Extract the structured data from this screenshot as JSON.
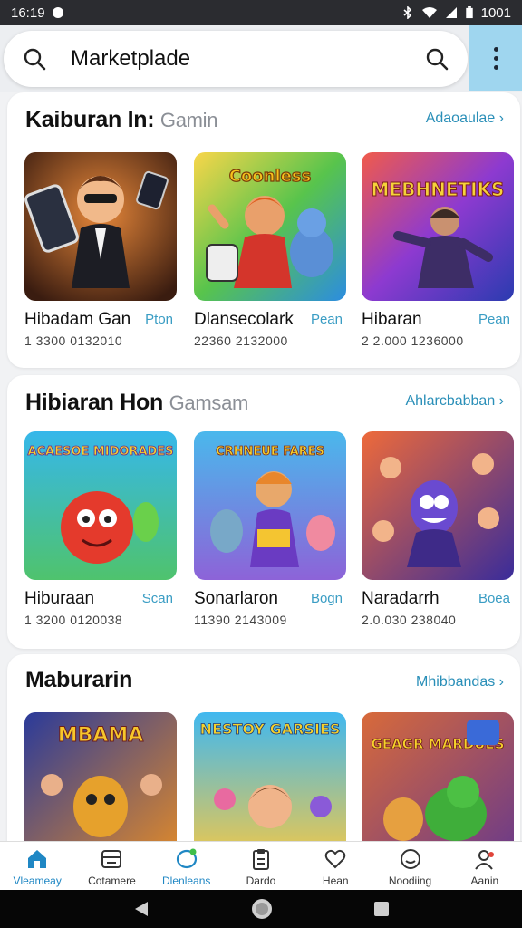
{
  "status": {
    "time": "16:19",
    "clock_right": "1001"
  },
  "header": {
    "title": "Marketplade"
  },
  "sections": [
    {
      "title": "Kaiburan In:",
      "title_muted": "Gamin",
      "link": "Adaoaulae",
      "games": [
        {
          "name": "Hibadam Gan",
          "tag": "Pton",
          "number": "1 3300 0132010"
        },
        {
          "name": "Dlansecolark",
          "tag": "Pean",
          "number": "22360 2132000"
        },
        {
          "name": "Hibaran",
          "tag": "Pean",
          "number": "2 2.000 1236000"
        }
      ]
    },
    {
      "title": "Hibiaran Hon",
      "title_muted": "Gamsam",
      "link": "Ahlarcbabban",
      "games": [
        {
          "name": "Hiburaan",
          "tag": "Scan",
          "number": "1 3200 0120038"
        },
        {
          "name": "Sonarlaron",
          "tag": "Bogn",
          "number": "11390 2143009"
        },
        {
          "name": "Naradarrh",
          "tag": "Boea",
          "number": "2.0.030 238040"
        }
      ]
    },
    {
      "title": "Maburarin",
      "title_muted": "",
      "link": "Mhibbandas",
      "games": [
        {},
        {},
        {}
      ]
    }
  ],
  "thumbnails": {
    "s0g0": {
      "caption": ""
    },
    "s0g1": {
      "caption": "Coonless"
    },
    "s0g2": {
      "caption": "MEBHNETIKS"
    },
    "s1g0": {
      "caption": "ACAESOE MIDORADES"
    },
    "s1g1": {
      "caption": "CRHNEUE FARES"
    },
    "s1g2": {
      "caption": ""
    },
    "s2g0": {
      "caption": "MBAMA"
    },
    "s2g1": {
      "caption": "NESTOY GARSIES"
    },
    "s2g2": {
      "caption": "GEAGR MARDUES"
    }
  },
  "bottom_nav": [
    {
      "label": "Vleameay",
      "icon": "home-icon",
      "active": true
    },
    {
      "label": "Cotamere",
      "icon": "card-icon",
      "active": false
    },
    {
      "label": "Dlenleans",
      "icon": "chat-icon",
      "active": false
    },
    {
      "label": "Dardo",
      "icon": "clipboard-icon",
      "active": false
    },
    {
      "label": "Hean",
      "icon": "heart-icon",
      "active": false
    },
    {
      "label": "Noodiing",
      "icon": "smiley-icon",
      "active": false
    },
    {
      "label": "Aanin",
      "icon": "user-icon",
      "active": false
    }
  ],
  "colors": {
    "accent": "#1f87c4",
    "link": "#2a8fb8",
    "menu_bg": "#9fd6ef",
    "status_bg": "#2b2c30"
  }
}
